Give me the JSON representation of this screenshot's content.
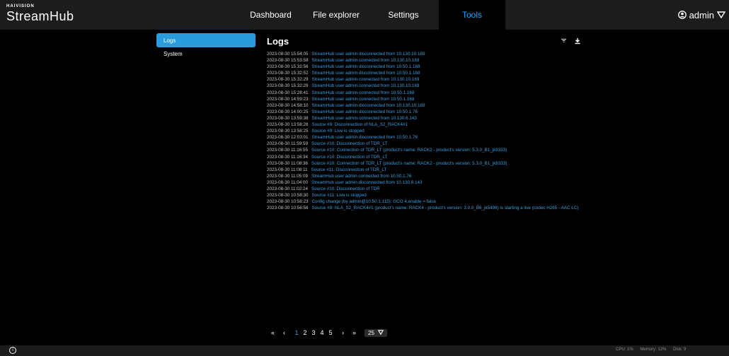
{
  "brand": {
    "small": "HAIVISION",
    "name": "StreamHub"
  },
  "nav": {
    "tabs": [
      "Dashboard",
      "File explorer",
      "Settings",
      "Tools"
    ],
    "active": "Tools"
  },
  "user": {
    "name": "admin"
  },
  "sidebar": {
    "items": [
      {
        "label": "Logs"
      },
      {
        "label": "System"
      }
    ]
  },
  "main": {
    "title": "Logs"
  },
  "logs": [
    {
      "ts": "2023-08-30 15:54:05",
      "msg": "StreamHub user admin disconnected from 10.130.10.169"
    },
    {
      "ts": "2023-08-30 15:53:58",
      "msg": "StreamHub user admin connected from 10.130.10.169"
    },
    {
      "ts": "2023-08-30 15:32:56",
      "msg": "StreamHub user admin disconnected from 10.50.1.168"
    },
    {
      "ts": "2023-08-30 15:32:52",
      "msg": "StreamHub user admin disconnected from 10.50.1.168"
    },
    {
      "ts": "2023-08-30 15:32:29",
      "msg": "StreamHub user admin connected from 10.130.10.169"
    },
    {
      "ts": "2023-08-30 15:32:29",
      "msg": "StreamHub user admin connected from 10.130.10.169"
    },
    {
      "ts": "2023-08-30 15:28:41",
      "msg": "StreamHub user admin connected from 10.50.1.168"
    },
    {
      "ts": "2023-08-30 14:59:23",
      "msg": "StreamHub user admin connected from 10.50.1.168"
    },
    {
      "ts": "2023-08-30 14:58:10",
      "msg": "StreamHub user admin disconnected from 10.130.10.169"
    },
    {
      "ts": "2023-08-30 14:00:25",
      "msg": "StreamHub user admin disconnected from 10.50.1.76"
    },
    {
      "ts": "2023-08-30 13:59:38",
      "msg": "StreamHub user admin connected from 10.130.6.143"
    },
    {
      "ts": "2023-08-30 13:58:28",
      "msg": "Source #9: Disconnection of NLA_S2_RACK4#1"
    },
    {
      "ts": "2023-08-30 13:58:25",
      "msg": "Source #9: Live is stopped"
    },
    {
      "ts": "2023-08-30 12:03:01",
      "msg": "StreamHub user admin disconnected from 10.50.1.76"
    },
    {
      "ts": "2023-08-30 11:59:59",
      "msg": "Source #10: Disconnection of TDR_LT"
    },
    {
      "ts": "2023-08-30 11:16:55",
      "msg": "Source #10: Connection of TDR_LT (product's name: RACK2 - product's version: 5.3.0_B1_jk8333)"
    },
    {
      "ts": "2023-08-30 11:16:34",
      "msg": "Source #10: Disconnection of TDR_LT"
    },
    {
      "ts": "2023-08-30 11:08:36",
      "msg": "Source #10: Connection of TDR_LT (product's name: RACK2 - product's version: 5.3.0_B1_jk8333)"
    },
    {
      "ts": "2023-08-30 11:08:11",
      "msg": "Source #11: Disconnection of TDR_LT"
    },
    {
      "ts": "2023-08-30 11:05:09",
      "msg": "StreamHub user admin connected from 10.50.1.76"
    },
    {
      "ts": "2023-08-30 11:04:00",
      "msg": "StreamHub user admin disconnected from 10.130.6.143"
    },
    {
      "ts": "2023-08-30 11:02:24",
      "msg": "Source #10: Disconnection of TDR"
    },
    {
      "ts": "2023-08-30 10:58:30",
      "msg": "Source #11: Live is stopped"
    },
    {
      "ts": "2023-08-30 10:58:23",
      "msg": "Config change (by admin@10.50.1.115): GCO 4.enable = false"
    },
    {
      "ts": "2023-08-30 10:56:56",
      "msg": "Source #9: NLA_S2_RACK4#1 (product's name: RACK4 - product's version: 3.0.0_B6_jk5496) is starting a live (codec H265 - AAC LC)"
    }
  ],
  "pagination": {
    "first": "«",
    "prev": "‹",
    "pages": [
      "1",
      "2",
      "3",
      "4",
      "5"
    ],
    "current": "1",
    "next": "›",
    "last": "»",
    "per_page": "25"
  },
  "footer": {
    "cpu": "CPU: 1%",
    "memory": "Memory: 12%",
    "disk": "Disk: 9"
  },
  "colors": {
    "accent": "#2a9bdc",
    "log_text": "#3a9fe0",
    "bar": "#1c1c1e"
  }
}
